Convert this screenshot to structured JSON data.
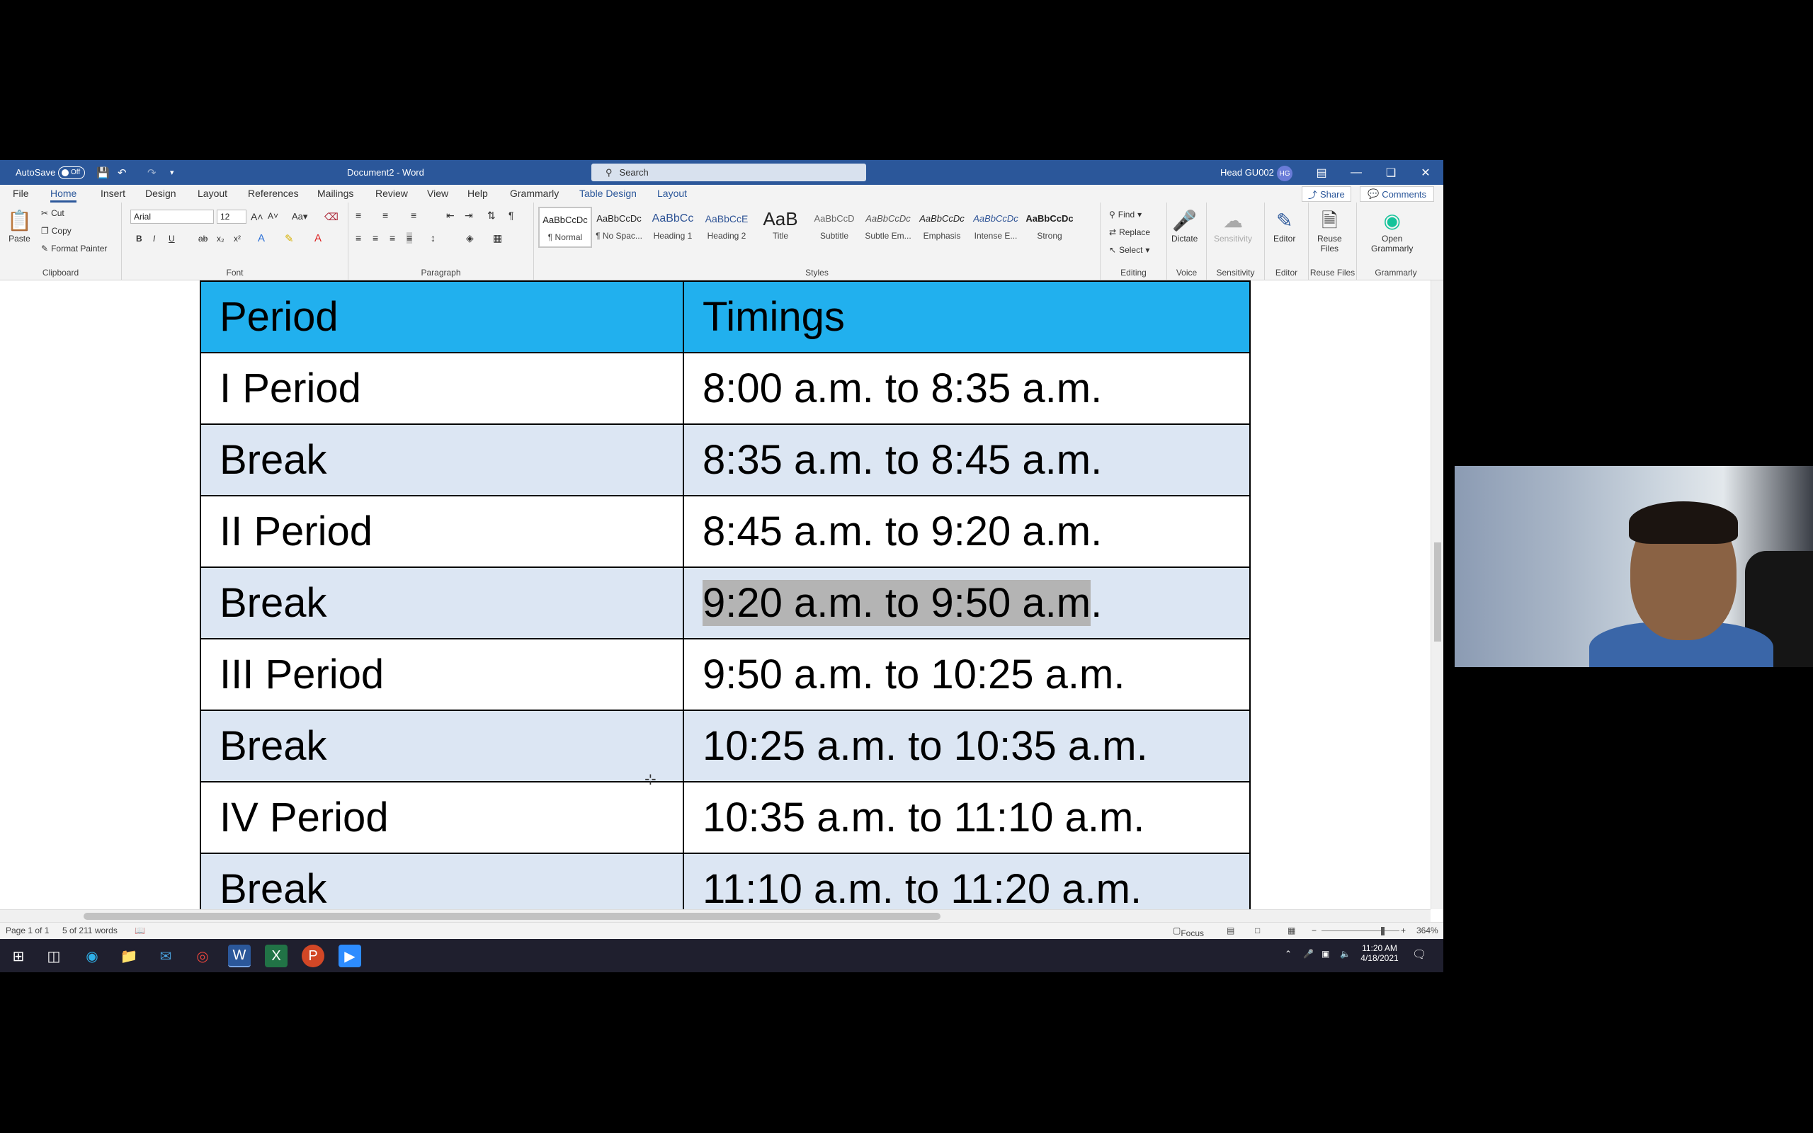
{
  "titlebar": {
    "autosave_label": "AutoSave",
    "autosave_state": "Off",
    "doc_title": "Document2 - Word",
    "search_placeholder": "Search",
    "user_name": "Head GU002",
    "user_initials": "HG"
  },
  "tabs": [
    "File",
    "Home",
    "Insert",
    "Design",
    "Layout",
    "References",
    "Mailings",
    "Review",
    "View",
    "Help",
    "Grammarly",
    "Table Design",
    "Layout"
  ],
  "share_label": "Share",
  "comments_label": "Comments",
  "ribbon": {
    "clipboard": {
      "paste": "Paste",
      "cut": "Cut",
      "copy": "Copy",
      "format_painter": "Format Painter",
      "label": "Clipboard"
    },
    "font": {
      "font_name": "Arial",
      "font_size": "12",
      "label": "Font"
    },
    "paragraph": {
      "label": "Paragraph"
    },
    "styles": {
      "label": "Styles",
      "items": [
        {
          "preview": "AaBbCcDc",
          "name": "¶ Normal"
        },
        {
          "preview": "AaBbCcDc",
          "name": "¶ No Spac..."
        },
        {
          "preview": "AaBbCc",
          "name": "Heading 1"
        },
        {
          "preview": "AaBbCcE",
          "name": "Heading 2"
        },
        {
          "preview": "AaB",
          "name": "Title"
        },
        {
          "preview": "AaBbCcD",
          "name": "Subtitle"
        },
        {
          "preview": "AaBbCcDc",
          "name": "Subtle Em..."
        },
        {
          "preview": "AaBbCcDc",
          "name": "Emphasis"
        },
        {
          "preview": "AaBbCcDc",
          "name": "Intense E..."
        },
        {
          "preview": "AaBbCcDc",
          "name": "Strong"
        }
      ]
    },
    "editing": {
      "find": "Find",
      "replace": "Replace",
      "select": "Select",
      "label": "Editing"
    },
    "voice": {
      "dictate": "Dictate",
      "label": "Voice"
    },
    "sensitivity": {
      "btn": "Sensitivity",
      "label": "Sensitivity"
    },
    "editor": {
      "btn": "Editor",
      "label": "Editor"
    },
    "reuse": {
      "btn_line1": "Reuse",
      "btn_line2": "Files",
      "label": "Reuse Files"
    },
    "grammarly": {
      "btn_line1": "Open",
      "btn_line2": "Grammarly",
      "label": "Grammarly"
    }
  },
  "table": {
    "header": {
      "period": "Period",
      "timings": "Timings"
    },
    "rows": [
      {
        "period": "I Period",
        "timings": "8:00 a.m. to 8:35 a.m."
      },
      {
        "period": "Break",
        "timings": "8:35 a.m. to 8:45 a.m."
      },
      {
        "period": "II Period",
        "timings": "8:45 a.m. to 9:20 a.m."
      },
      {
        "period": "Break",
        "timings_highlight": "9:20 a.m. to 9:50 a.m",
        "timings_rest": "."
      },
      {
        "period": "III Period",
        "timings": "9:50 a.m. to 10:25 a.m."
      },
      {
        "period": "Break",
        "timings": "10:25 a.m. to 10:35 a.m."
      },
      {
        "period": "IV Period",
        "timings": "10:35 a.m. to 11:10 a.m."
      },
      {
        "period": "Break",
        "timings": "11:10 a.m. to 11:20 a.m."
      }
    ]
  },
  "statusbar": {
    "page": "Page 1 of 1",
    "words": "5 of 211 words",
    "focus": "Focus",
    "zoom": "364%"
  },
  "taskbar": {
    "time": "11:20 AM",
    "date": "4/18/2021"
  }
}
